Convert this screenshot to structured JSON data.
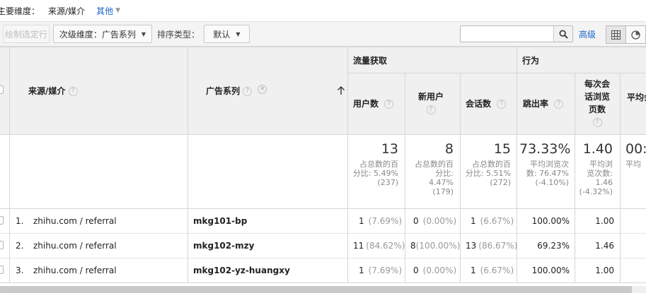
{
  "dimension_bar": {
    "label": "主要维度：",
    "primary": "来源/媒介",
    "other": "其他"
  },
  "toolbar": {
    "plot_rows": "绘制选定行",
    "secondary_dim": "次级维度：广告系列",
    "sort_type_label": "排序类型：",
    "sort_type_value": "默认",
    "search_value": "",
    "advanced": "高级"
  },
  "headers": {
    "source_medium": "来源/媒介",
    "campaign": "广告系列",
    "acquisition": "流量获取",
    "behavior": "行为",
    "users": "用户数",
    "new_users": "新用户",
    "sessions": "会话数",
    "bounce_rate": "跳出率",
    "pages_per_session": "每次会话浏览页数",
    "avg_duration": "平均会"
  },
  "totals": {
    "users": {
      "value": "13",
      "line1": "占总数的百",
      "line2": "分比: 5.49%",
      "line3": "(237)"
    },
    "new_users": {
      "value": "8",
      "line1": "占总数的百",
      "line2": "分比:",
      "line3": "4.47%",
      "line4": "(179)"
    },
    "sessions": {
      "value": "15",
      "line1": "占总数的百",
      "line2": "分比: 5.51%",
      "line3": "(272)"
    },
    "bounce_rate": {
      "value": "73.33%",
      "line1": "平均浏览次",
      "line2": "数: 76.47%",
      "line3": "(-4.10%)"
    },
    "pages_per_session": {
      "value": "1.40",
      "line1": "平均浏",
      "line2": "览次数:",
      "line3": "1.46",
      "line4": "(-4.32%)"
    },
    "avg_duration": {
      "value": "00:",
      "line1": "平均"
    }
  },
  "rows": [
    {
      "index": "1.",
      "source": "zhihu.com / referral",
      "campaign": "mkg101-bp",
      "users": "1",
      "users_pct": "(7.69%)",
      "new_users": "0",
      "new_users_pct": "(0.00%)",
      "sessions": "1",
      "sessions_pct": "(6.67%)",
      "bounce": "100.00%",
      "pages": "1.00"
    },
    {
      "index": "2.",
      "source": "zhihu.com / referral",
      "campaign": "mkg102-mzy",
      "users": "11",
      "users_pct": "(84.62%)",
      "new_users": "8",
      "new_users_pct": "(100.00%)",
      "sessions": "13",
      "sessions_pct": "(86.67%)",
      "bounce": "69.23%",
      "pages": "1.46"
    },
    {
      "index": "3.",
      "source": "zhihu.com / referral",
      "campaign": "mkg102-yz-huangxy",
      "users": "1",
      "users_pct": "(7.69%)",
      "new_users": "0",
      "new_users_pct": "(0.00%)",
      "sessions": "1",
      "sessions_pct": "(6.67%)",
      "bounce": "100.00%",
      "pages": "1.00"
    }
  ],
  "icons": {
    "search": "search-icon",
    "table_view": "table-view-icon",
    "pie_view": "pie-view-icon",
    "sort": "sort-up-arrow-icon",
    "remove": "remove-dimension-icon"
  },
  "colors": {
    "link": "#1a66cc",
    "header_bg": "#f0f0f0",
    "border": "#d6d6d6"
  }
}
